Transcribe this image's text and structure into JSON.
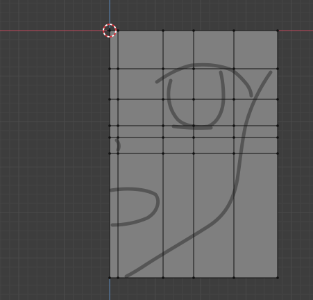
{
  "viewport": {
    "background_color": "#3d3d3d",
    "grid_minor_color": "#454545",
    "grid_major_color": "#4b4b4b",
    "axis_x_color": "#c0485a",
    "axis_y_color": "#5a86b8",
    "cursor_icon": "3d-cursor-icon"
  },
  "mesh": {
    "face_color": "#7f7f7f",
    "edge_color": "#111111",
    "vertex_color": "#111111"
  },
  "reference_drawing": {
    "stroke_color": "#555555"
  }
}
